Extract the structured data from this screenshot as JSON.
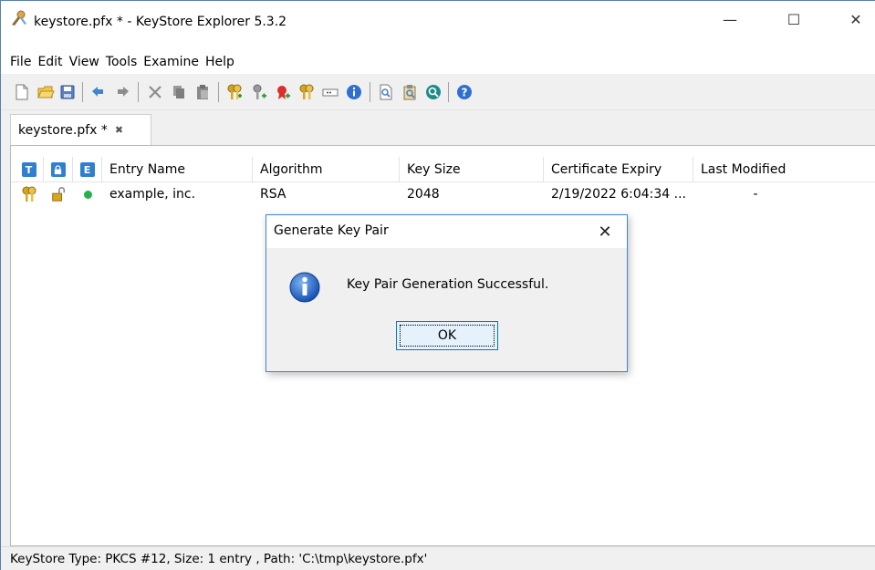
{
  "window": {
    "title": "keystore.pfx * - KeyStore Explorer 5.3.2",
    "minimize_label": "—",
    "maximize_label": "☐",
    "close_label": "✕"
  },
  "menu": [
    "File",
    "Edit",
    "View",
    "Tools",
    "Examine",
    "Help"
  ],
  "toolbar_icons": [
    "new-icon",
    "open-icon",
    "save-icon",
    "undo-icon",
    "redo-icon",
    "cut-icon",
    "copy-icon",
    "paste-icon",
    "generate-key-pair-icon",
    "generate-secret-key-icon",
    "import-trusted-certificate-icon",
    "import-key-pair-icon",
    "set-password-icon",
    "properties-icon",
    "examine-file-icon",
    "examine-clipboard-icon",
    "examine-ssl-icon",
    "help-icon"
  ],
  "tab": {
    "label": "keystore.pfx *",
    "close_label": "✖"
  },
  "table": {
    "headers": {
      "type": "T",
      "lock": "",
      "expiry_status": "E",
      "entry_name": "Entry Name",
      "algorithm": "Algorithm",
      "key_size": "Key Size",
      "certificate_expiry": "Certificate Expiry",
      "last_modified": "Last Modified"
    },
    "rows": [
      {
        "entry_name": "example, inc.",
        "algorithm": "RSA",
        "key_size": "2048",
        "certificate_expiry": "2/19/2022 6:04:34 ...",
        "last_modified": "-",
        "status_color": "#23b14d"
      }
    ]
  },
  "status": "KeyStore Type: PKCS #12, Size: 1 entry , Path: 'C:\\tmp\\keystore.pfx'",
  "dialog": {
    "title": "Generate Key Pair",
    "close_label": "✕",
    "message": "Key Pair Generation Successful.",
    "ok_label": "OK"
  },
  "colors": {
    "accent": "#0078d7",
    "dialog_border": "#3f87d6",
    "badge_blue": "#2f7fd0",
    "status_green": "#23b14d"
  }
}
